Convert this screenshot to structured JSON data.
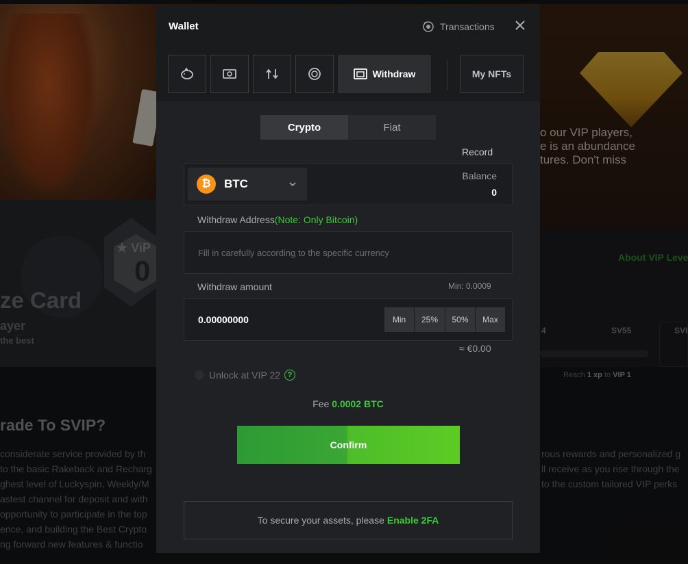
{
  "background": {
    "hero_text": [
      "o our VIP players,",
      "e is an abundance",
      "tures. Don't miss"
    ],
    "vip_badge_label": "★ ViP",
    "vip_badge_num": "0",
    "card_title": "ze Card",
    "card_sub1": "ayer",
    "card_sub2": "the best",
    "about_vip_link": "About VIP Leve",
    "levels": [
      "4",
      "SV55",
      "SVI"
    ],
    "reach": {
      "prefix": "Reach",
      "xp": "1 xp",
      "to": "to",
      "vip": "VIP 1"
    },
    "section_title": "rade To SVIP?",
    "para_left": [
      "considerate service provided by th",
      "to the basic Rakeback and Recharg",
      "ghest level of Luckyspin, Weekly/M",
      "astest channel for deposit and with",
      "opportunity to participate in the top",
      "ence, and building the Best Crypto",
      "ng forward new features & functio"
    ],
    "para_right": [
      "rous rewards and personalized g",
      "ll receive as you rise through the",
      "to the custom tailored VIP perks"
    ]
  },
  "wallet": {
    "title": "Wallet",
    "transactions_label": "Transactions",
    "tabs": {
      "icons": [
        "piggy-bank-icon",
        "cash-icon",
        "swap-icon",
        "vault-icon"
      ],
      "withdraw_label": "Withdraw",
      "nfts_label": "My NFTs"
    },
    "segment": {
      "crypto": "Crypto",
      "fiat": "Fiat"
    },
    "record_label": "Record",
    "coin": {
      "symbol": "BTC",
      "balance_label": "Balance",
      "balance_value": "0"
    },
    "address": {
      "label": "Withdraw Address",
      "note": "(Note: Only Bitcoin)",
      "placeholder": "Fill in carefully according to the specific currency",
      "value": ""
    },
    "amount": {
      "label": "Withdraw amount",
      "min_note": "Min: 0.0009",
      "value": "0.00000000",
      "quick": [
        "Min",
        "25%",
        "50%",
        "Max"
      ],
      "approx": "≈ €0.00"
    },
    "unlock_label": "Unlock at VIP 22",
    "fee": {
      "label": "Fee",
      "value": "0.0002 BTC"
    },
    "confirm_label": "Confirm",
    "secure": {
      "text": "To secure your assets, please",
      "link": "Enable 2FA"
    },
    "colors": {
      "accent": "#3ec93a",
      "btc": "#f7931a"
    }
  }
}
